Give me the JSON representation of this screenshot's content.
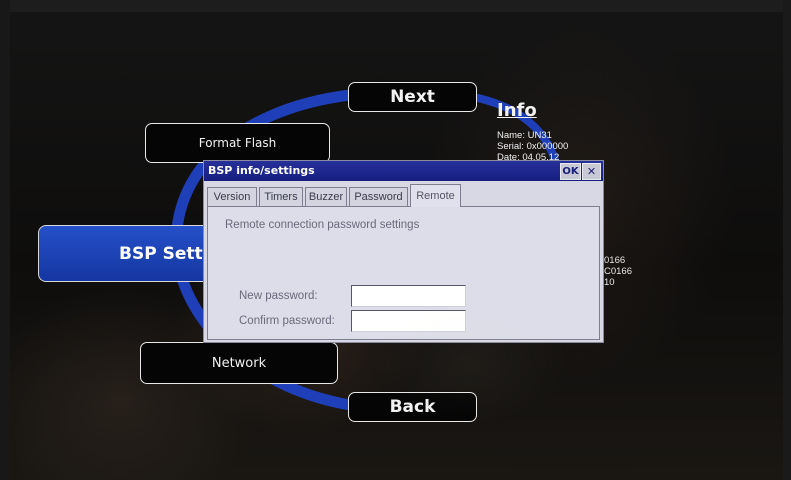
{
  "menu": {
    "next_label": "Next",
    "back_label": "Back",
    "format_flash_label": "Format Flash",
    "network_label": "Network",
    "bsp_settings_label": "BSP Setting"
  },
  "info": {
    "title": "Info",
    "name_line": "Name:  UN31",
    "serial_line": "Serial:  0x000000",
    "date_line": "Date:  04.05.12",
    "side_values": [
      "0166",
      "C0166",
      "10"
    ]
  },
  "dialog": {
    "title": "BSP info/settings",
    "ok_label": "OK",
    "close_label": "✕",
    "tabs": [
      {
        "label": "Version",
        "active": false
      },
      {
        "label": "Timers",
        "active": false
      },
      {
        "label": "Buzzer",
        "active": false
      },
      {
        "label": "Password",
        "active": false
      },
      {
        "label": "Remote",
        "active": true
      }
    ],
    "heading": "Remote connection password settings",
    "new_password_label": "New password:",
    "new_password_value": "",
    "confirm_password_label": "Confirm password:",
    "confirm_password_value": ""
  },
  "colors": {
    "arc_blue": "#1f3fb8",
    "titlebar_blue": "#1c2790",
    "dialog_bg": "#d7d8e4"
  },
  "icons": {
    "close": "close-icon"
  }
}
